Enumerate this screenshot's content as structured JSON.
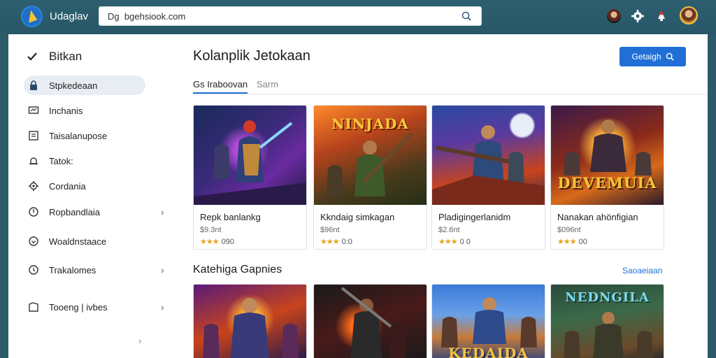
{
  "app": {
    "title": "Udaglav"
  },
  "search": {
    "value": "bgehsiook.com",
    "prefix": "Dg"
  },
  "sidebar": {
    "title": "Bitkan",
    "items": [
      {
        "label": "Stpkedeaan",
        "icon": "lock-icon",
        "active": true
      },
      {
        "label": "Inchanis",
        "icon": "monitor-icon"
      },
      {
        "label": "Taisalanupose",
        "icon": "list-icon"
      },
      {
        "label": "Tatok:",
        "icon": "bell-icon"
      },
      {
        "label": "Cordania",
        "icon": "gear-icon"
      },
      {
        "label": "Ropbandlaia",
        "icon": "shield-icon",
        "chevron": true
      },
      {
        "label": "Woaldnstaace",
        "icon": "heart-icon"
      },
      {
        "label": "Trakalomes",
        "icon": "badge-icon",
        "chevron": true
      },
      {
        "label": "Tooeng | ivbes",
        "icon": "folder-icon",
        "chevron": true
      }
    ]
  },
  "main": {
    "title": "Kolanplik Jetokaan",
    "primary_button": "Getaigh",
    "tabs": [
      {
        "label": "Gs Iraboovan",
        "active": true
      },
      {
        "label": "Sarm",
        "active": false
      }
    ],
    "cards": [
      {
        "title": "Repk banlankg",
        "sub": "$9.3nt",
        "rating": "090",
        "stars": "★★★"
      },
      {
        "title": "Kkndaig simkagan",
        "sub": "$96nt",
        "rating": "0:0",
        "stars": "★★★"
      },
      {
        "title": "Pladigingerlanidm",
        "sub": "$2.6nt",
        "rating": "0 0",
        "stars": "★★★"
      },
      {
        "title": "Nanakan ahönfigian",
        "sub": "$096nt",
        "rating": "00",
        "stars": "★★★"
      }
    ],
    "thumb_text": [
      "",
      "NINJADA",
      "",
      "DEVEMUIA"
    ],
    "section": {
      "title": "Katehiga Gapnies",
      "link": "Saoaeiaan"
    },
    "thumb2_text": [
      "",
      "",
      "KEDAIDA",
      "NEDNGILA"
    ]
  }
}
